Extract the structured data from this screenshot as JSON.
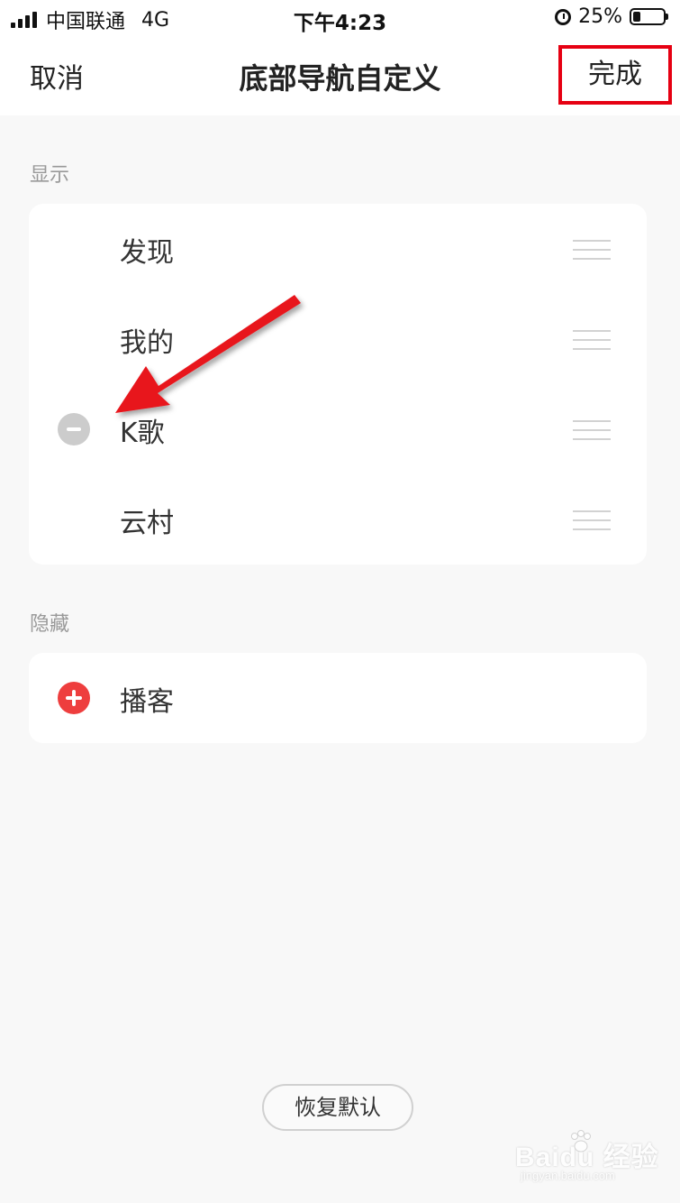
{
  "status_bar": {
    "carrier": "中国联通",
    "network": "4G",
    "time": "下午4:23",
    "battery_text": "25%",
    "battery_level": 0.25
  },
  "nav": {
    "cancel_label": "取消",
    "title": "底部导航自定义",
    "done_label": "完成",
    "highlight_color": "#e60012"
  },
  "shown": {
    "label": "显示",
    "items": [
      {
        "label": "发现"
      },
      {
        "label": "我的"
      },
      {
        "label": "K歌",
        "icon": "remove-icon"
      },
      {
        "label": "云村"
      }
    ]
  },
  "hidden": {
    "label": "隐藏",
    "items": [
      {
        "label": "播客",
        "icon": "add-icon"
      }
    ]
  },
  "restore_label": "恢复默认",
  "watermark": {
    "brand": "Baidu 经验",
    "site": "jingyan.baidu.com"
  },
  "colors": {
    "accent_red": "#ee3e3e",
    "annotation_red": "#e60012"
  }
}
